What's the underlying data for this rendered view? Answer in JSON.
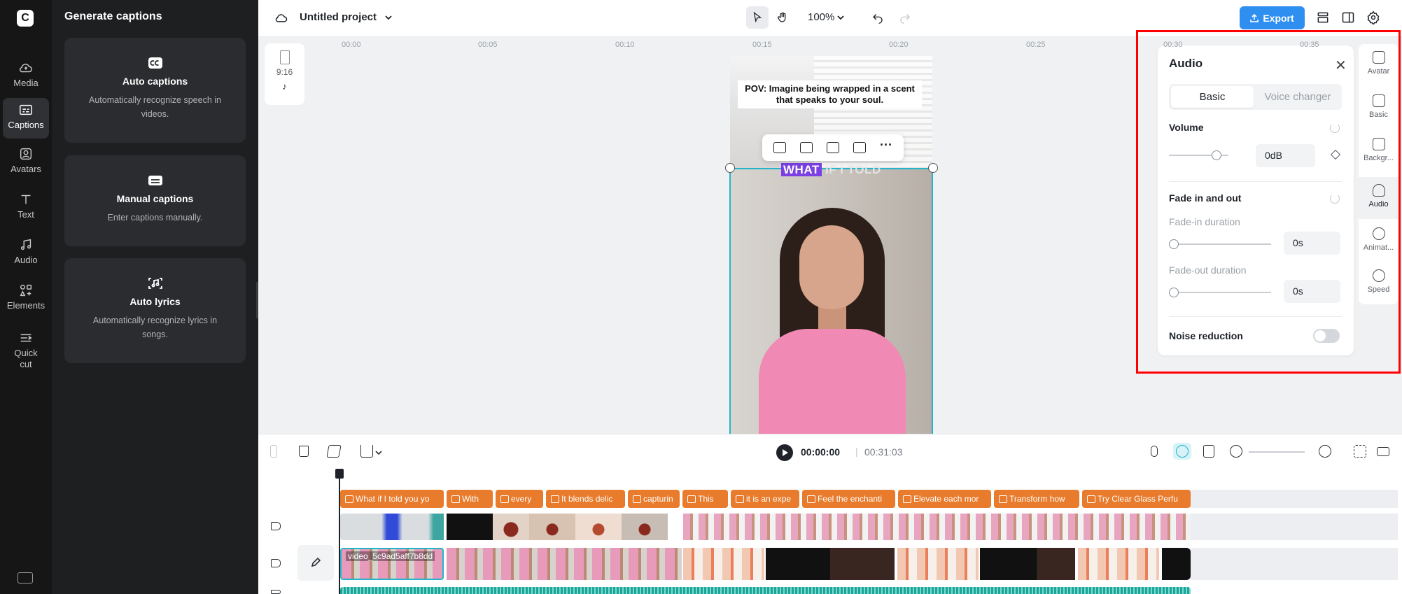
{
  "app": {
    "logo_text": "C"
  },
  "rail": {
    "items": [
      {
        "label": "Media",
        "icon": "cloud-icon"
      },
      {
        "label": "Captions",
        "icon": "captions-icon",
        "active": true
      },
      {
        "label": "Avatars",
        "icon": "avatar-icon"
      },
      {
        "label": "Text",
        "icon": "text-icon"
      },
      {
        "label": "Audio",
        "icon": "music-note-icon"
      },
      {
        "label": "Elements",
        "icon": "elements-icon"
      },
      {
        "label": "Quick\ncut",
        "icon": "quick-cut-icon"
      }
    ]
  },
  "captions_panel": {
    "title": "Generate captions",
    "cards": [
      {
        "title": "Auto captions",
        "desc": "Automatically recognize speech in videos.",
        "icon": "cc-icon"
      },
      {
        "title": "Manual captions",
        "desc": "Enter captions manually.",
        "icon": "keyboard-icon"
      },
      {
        "title": "Auto lyrics",
        "desc": "Automatically recognize lyrics in songs.",
        "icon": "music-scan-icon"
      }
    ]
  },
  "topbar": {
    "project_title": "Untitled project",
    "zoom": "100%",
    "export_label": "Export"
  },
  "canvas": {
    "ratio_label": "9:16",
    "ratio_platform_icon": "tiktok-icon",
    "overlay_text": "POV: Imagine being wrapped in a scent that speaks to your soul.",
    "caption_highlight": "WHAT",
    "caption_rest": " IF I TOLD"
  },
  "side_nav": {
    "items": [
      {
        "label": "Avatar"
      },
      {
        "label": "Basic"
      },
      {
        "label": "Backgr..."
      },
      {
        "label": "Audio",
        "active": true
      },
      {
        "label": "Animat..."
      },
      {
        "label": "Speed"
      }
    ]
  },
  "audio_panel": {
    "title": "Audio",
    "tabs": [
      "Basic",
      "Voice changer"
    ],
    "active_tab": "Basic",
    "volume_label": "Volume",
    "volume_value": "0dB",
    "volume_level": 0.8,
    "fade_label": "Fade in and out",
    "fade_in_label": "Fade-in duration",
    "fade_in_value": "0s",
    "fade_out_label": "Fade-out duration",
    "fade_out_value": "0s",
    "noise_label": "Noise reduction",
    "noise_enabled": false
  },
  "timeline": {
    "current_time": "00:00:00",
    "separator": "|",
    "total_time": "00:31:03",
    "ruler": [
      "00:00",
      "00:05",
      "00:10",
      "00:15",
      "00:20",
      "00:25",
      "00:30",
      "00:35"
    ],
    "caption_clips": [
      "What if I told you yo",
      "With",
      "every",
      "It blends delic",
      "capturin",
      "This",
      "it is an expe",
      "Feel the enchanti",
      "Elevate each mor",
      "Transform how",
      "Try Clear Glass Perfu"
    ],
    "main_clip_name": "video_5c9ad5aff7b8dd"
  },
  "colors": {
    "accent": "#2e8ff0",
    "caption_clip": "#e87b2c",
    "selection": "#22b5cc",
    "highlight_box": "#ff0000",
    "caption_highlight": "#7b3fe4"
  }
}
